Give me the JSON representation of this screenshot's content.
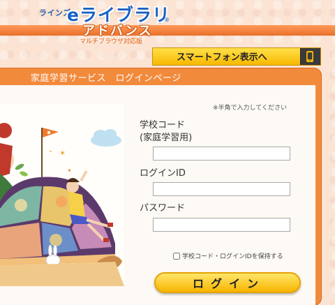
{
  "header": {
    "logo_small": "ラインズ",
    "logo_main": "eライブラリ",
    "logo_registered": "®",
    "logo_sub": "アドバンス",
    "logo_tagline": "マルチブラウザ対応版"
  },
  "smartphone": {
    "label": "スマートフォン表示へ",
    "icon": "smartphone-icon"
  },
  "login": {
    "title": "家庭学習サービス　ログインページ",
    "notice": "※半角で入力してください",
    "school_code_label": "学校コード",
    "school_code_sublabel": "(家庭学習用)",
    "school_code_value": "",
    "login_id_label": "ログインID",
    "login_id_value": "",
    "password_label": "パスワード",
    "password_value": "",
    "remember_label": "学校コード・ログインIDを保持する",
    "remember_checked": false,
    "submit_label": "ログイン"
  },
  "colors": {
    "accent_orange": "#f28a3c",
    "button_yellow": "#f7b800",
    "logo_blue": "#1a62c4"
  }
}
